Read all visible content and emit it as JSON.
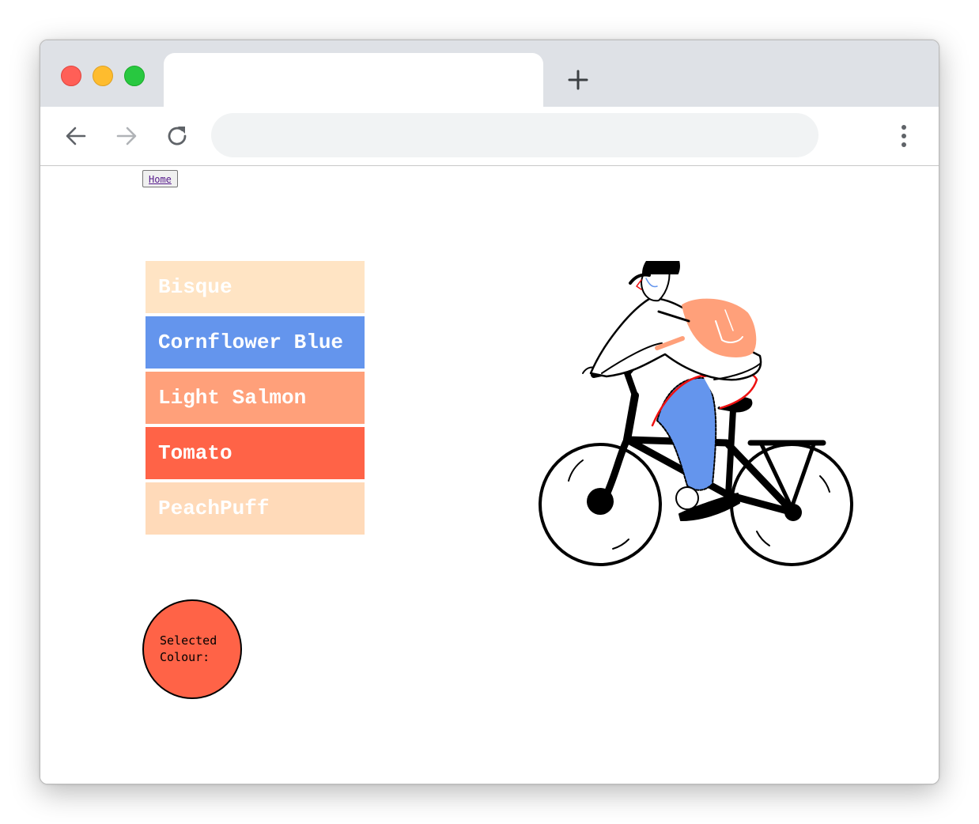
{
  "browser": {
    "tab_title": "",
    "address": ""
  },
  "page": {
    "home_link": "Home",
    "colors": [
      {
        "label": "Bisque",
        "hex": "#ffe4c4"
      },
      {
        "label": "Cornflower Blue",
        "hex": "#6495ed"
      },
      {
        "label": "Light Salmon",
        "hex": "#ffa07a"
      },
      {
        "label": "Tomato",
        "hex": "#ff6347"
      },
      {
        "label": "PeachPuff",
        "hex": "#ffdab9"
      }
    ],
    "selected": {
      "label": "Selected Colour:",
      "color": "#ff6347"
    },
    "illustration": {
      "icon": "cyclist-illustration",
      "jacket_color": "#6495ed",
      "backpack_color": "#ffa07a"
    }
  }
}
